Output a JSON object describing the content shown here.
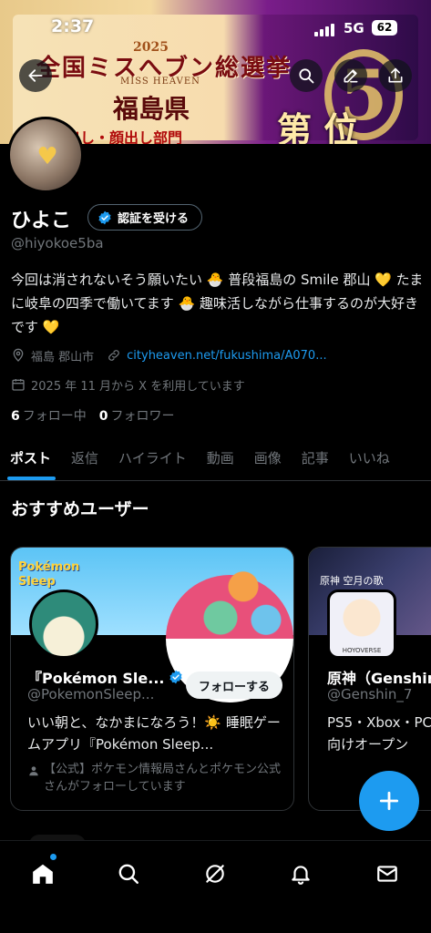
{
  "status_bar": {
    "time": "2:37",
    "network": "5G",
    "battery": "62"
  },
  "banner": {
    "line1": "全国ミスへブン総選挙",
    "year": "2025",
    "subtitle": "MISS HEAVEN",
    "prefecture": "福島県",
    "tag": "目出し・顔出し部門",
    "rank_label": "第 位",
    "rank_number": "5",
    "colors": {
      "gold": "#e8c66a",
      "purple": "#6b1778",
      "cream": "#f6e2b6"
    }
  },
  "top_bar": {
    "back_icon": "arrow-left-icon",
    "search_icon": "search-icon",
    "edit_icon": "edit-icon",
    "share_icon": "share-icon"
  },
  "profile": {
    "name": "ひよこ",
    "verify_label": "認証を受ける",
    "handle": "@hiyokoe5ba",
    "bio": "今回は消されないそう願いたい 🐣 普段福島の Smile 郡山 💛 たまに岐阜の四季で働いてます 🐣 趣味活しながら仕事するのが大好きです 💛",
    "location": "福島 郡山市",
    "website": "cityheaven.net/fukushima/A070...",
    "joined": "2025 年 11 月から X を利用しています",
    "following_count": "6",
    "following_label": "フォロー中",
    "followers_count": "0",
    "followers_label": "フォロワー"
  },
  "tabs": [
    "ポスト",
    "返信",
    "ハイライト",
    "動画",
    "画像",
    "記事",
    "いいね"
  ],
  "recommended": {
    "title": "おすすめユーザー",
    "cards": [
      {
        "name": "『Pokémon Sle...",
        "handle": "@PokemonSleep...",
        "follow_label": "フォローする",
        "description": "いい朝と、なかまになろう！☀️ 睡眠ゲームアプリ『Pokémon Sleep...",
        "social_context": "【公式】ポケモン情報局さんとポケモン公式さんがフォローしています",
        "cover_logo": "Pokémon Sleep",
        "verified": true
      },
      {
        "name": "原神（Genshin",
        "handle": "@Genshin_7",
        "cover_logo": "原神 空月の歌",
        "avatar_label": "HOYOVERSE",
        "description": "PS5・Xbox・PC 向けオープン",
        "verified": false
      }
    ]
  },
  "fab_icon": "plus-icon",
  "bottom_nav": [
    "home-icon",
    "search-icon",
    "grok-icon",
    "bell-icon",
    "mail-icon"
  ],
  "colors": {
    "accent": "#1d9bf0",
    "background": "#000000",
    "muted": "#71767b"
  }
}
